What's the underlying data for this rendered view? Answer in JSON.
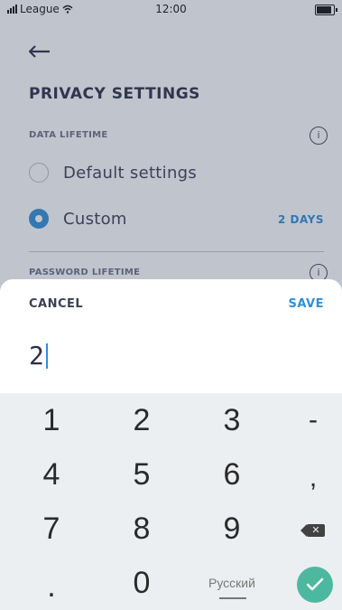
{
  "status_bar": {
    "carrier": "League",
    "time": "12:00"
  },
  "page": {
    "title": "PRIVACY SETTINGS",
    "data_lifetime": {
      "label": "DATA LIFETIME",
      "options": [
        {
          "label": "Default settings",
          "selected": false
        },
        {
          "label": "Custom",
          "selected": true,
          "value": "2 DAYS"
        }
      ]
    },
    "password_lifetime": {
      "label": "PASSWORD LIFETIME"
    }
  },
  "sheet": {
    "cancel_label": "CANCEL",
    "save_label": "SAVE",
    "input_value": "2"
  },
  "keyboard": {
    "rows": [
      [
        "1",
        "2",
        "3",
        "-"
      ],
      [
        "4",
        "5",
        "6",
        ","
      ],
      [
        "7",
        "8",
        "9",
        "backspace"
      ],
      [
        ".",
        "0",
        "Русский",
        "ok"
      ]
    ],
    "language_label": "Русский",
    "accent_color": "#4db8a0"
  },
  "colors": {
    "accent": "#2f8fd8",
    "confirm": "#4db8a0",
    "overlay": "#3c4664"
  }
}
